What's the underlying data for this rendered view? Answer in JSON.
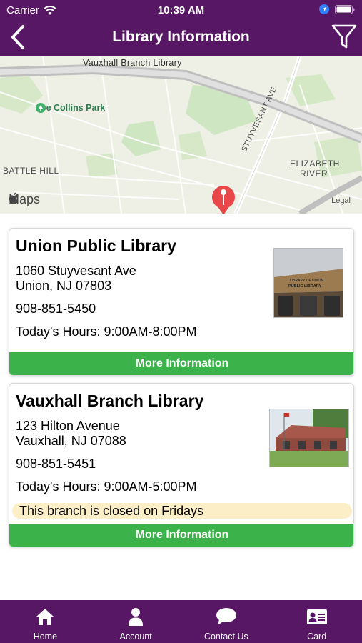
{
  "status_bar": {
    "carrier": "Carrier",
    "time": "10:39 AM"
  },
  "nav": {
    "title": "Library Information"
  },
  "map": {
    "road_labels": {
      "branch": "Vauxhall Branch Library",
      "street": "STUYVESANT AVE"
    },
    "area_labels": {
      "battle_hill": "BATTLE HILL",
      "elizabeth": "ELIZABETH",
      "river": "RIVER"
    },
    "park_label": "Joe Collins Park",
    "brand": "Maps",
    "legal": "Legal"
  },
  "libraries": [
    {
      "name": "Union Public Library",
      "address_line1": "1060 Stuyvesant Ave",
      "address_line2": "Union, NJ 07803",
      "phone": "908-851-5450",
      "hours": "Today's Hours: 9:00AM-8:00PM",
      "button": "More Information"
    },
    {
      "name": "Vauxhall Branch Library",
      "address_line1": "123 Hilton Avenue",
      "address_line2": "Vauxhall, NJ 07088",
      "phone": "908-851-5451",
      "hours": "Today's Hours: 9:00AM-5:00PM",
      "notice": "This branch is closed on Fridays",
      "button": "More Information"
    }
  ],
  "thumb_text": {
    "line1": "LIBRARY OF UNION",
    "line2": "PUBLIC LIBRARY"
  },
  "tabs": [
    {
      "label": "Home",
      "icon": "home-icon"
    },
    {
      "label": "Account",
      "icon": "person-icon"
    },
    {
      "label": "Contact Us",
      "icon": "chat-bubble-icon"
    },
    {
      "label": "Card",
      "icon": "id-card-icon"
    }
  ],
  "colors": {
    "brand_purple": "#571764",
    "button_green": "#3cb24a",
    "notice_bg": "#fcefc8",
    "pin_red": "#e8484a"
  }
}
